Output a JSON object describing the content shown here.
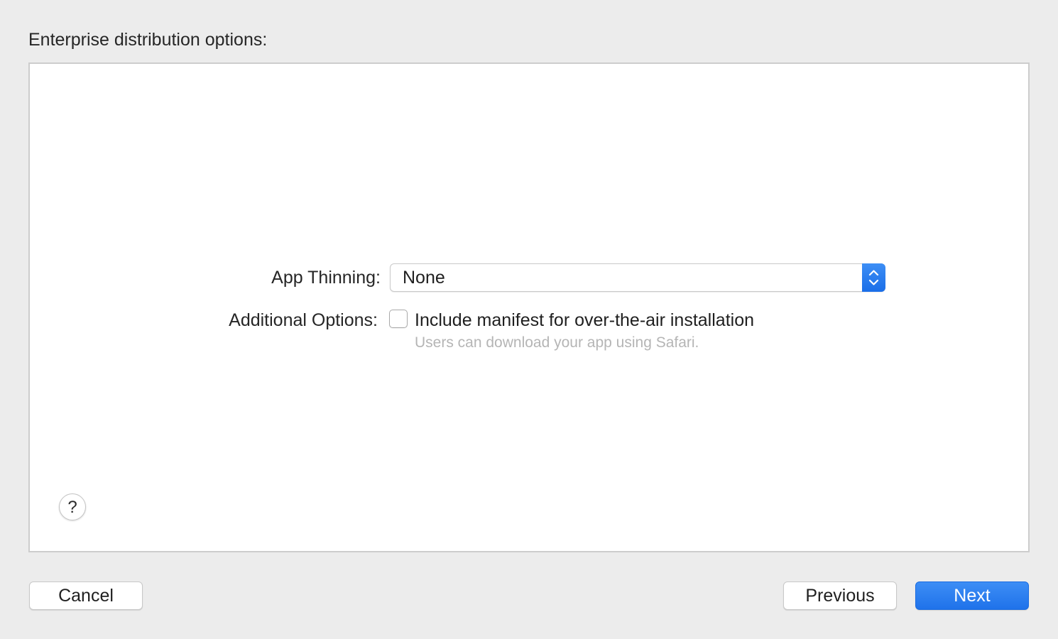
{
  "sheet": {
    "title": "Enterprise distribution options:"
  },
  "form": {
    "app_thinning": {
      "label": "App Thinning:",
      "selected_value": "None"
    },
    "additional_options": {
      "label": "Additional Options:",
      "checkbox_label": "Include manifest for over-the-air installation",
      "checkbox_checked": false,
      "hint": "Users can download your app using Safari."
    }
  },
  "help": {
    "glyph": "?",
    "icon": "help-icon"
  },
  "footer": {
    "cancel_label": "Cancel",
    "previous_label": "Previous",
    "next_label": "Next"
  },
  "colors": {
    "accent": "#1f72ea",
    "window_background": "#ececec",
    "panel_background": "#ffffff",
    "hint_text": "#b5b5b5"
  }
}
